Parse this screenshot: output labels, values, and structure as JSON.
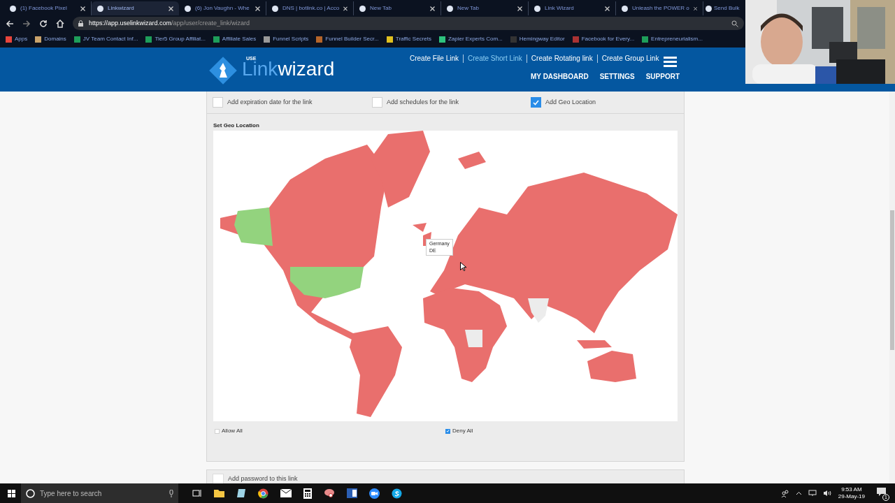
{
  "browser": {
    "tabs": [
      {
        "title": "(1) Facebook Pixel",
        "selected": false
      },
      {
        "title": "Linkwizard",
        "selected": true
      },
      {
        "title": "(6) Jon Vaughn - Whe",
        "selected": false
      },
      {
        "title": "DNS | botlink.co | Acco",
        "selected": false
      },
      {
        "title": "New Tab",
        "selected": false
      },
      {
        "title": "New Tab",
        "selected": false
      },
      {
        "title": "Link Wizard",
        "selected": false
      },
      {
        "title": "Unleash the POWER o",
        "selected": false
      },
      {
        "title": "Send Bulk",
        "selected": false
      }
    ],
    "url": {
      "scheme": "https://",
      "domain": "app.uselinkwizard.com",
      "path": "/app/user/create_link/wizard"
    },
    "bookmarks": [
      "Apps",
      "Domains",
      "JV Team Contact Inf...",
      "Tier5 Group Affiliat...",
      "Affiliate Sales",
      "Funnel Scripts",
      "Funnel Builder Secr...",
      "Traffic Secrets",
      "Zapier Experts Com...",
      "Hemingway Editor",
      "Facebook for Every...",
      "Entrepreneurialism..."
    ]
  },
  "header": {
    "logo": {
      "prefix": "USE",
      "first": "Link",
      "second": "wizard"
    },
    "nav": [
      {
        "label": "Create File Link",
        "selected": false
      },
      {
        "label": "Create Short Link",
        "selected": true
      },
      {
        "label": "Create Rotating link",
        "selected": false
      },
      {
        "label": "Create Group Link",
        "selected": false
      }
    ],
    "subnav": [
      "MY DASHBOARD",
      "SETTINGS",
      "SUPPORT"
    ]
  },
  "options": [
    {
      "label": "Add expiration date for the link",
      "checked": false
    },
    {
      "label": "Add schedules for the link",
      "checked": false
    },
    {
      "label": "Add Geo Location",
      "checked": true
    }
  ],
  "geo": {
    "title": "Set Geo Location",
    "tooltip": {
      "name": "Germany",
      "code": "DE"
    },
    "controls": [
      {
        "label": "Allow All",
        "checked": false
      },
      {
        "label": "Deny All",
        "checked": true
      }
    ]
  },
  "password_option": {
    "label": "Add password to this link",
    "checked": false
  },
  "taskbar": {
    "search_placeholder": "Type here to search",
    "time": "9:53 AM",
    "date": "29-May-19",
    "notifications": "1"
  }
}
